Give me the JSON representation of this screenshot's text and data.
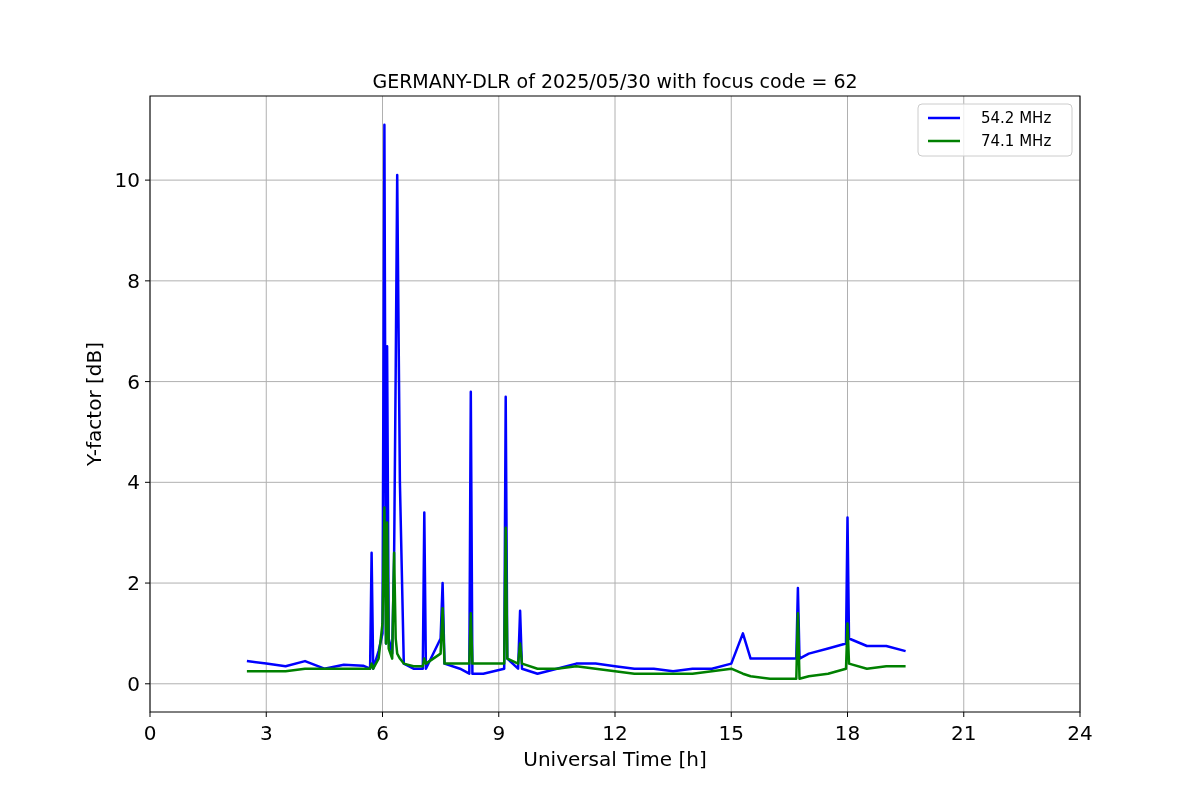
{
  "figure": {
    "chart_data": {
      "type": "line",
      "title": "GERMANY-DLR of 2025/05/30 with focus code = 62",
      "xlabel": "Universal Time [h]",
      "ylabel": "Y-factor [dB]",
      "x": [
        2.5,
        3,
        3.5,
        4,
        4.5,
        5,
        5.5,
        5.68,
        5.72,
        5.76,
        5.9,
        6.0,
        6.05,
        6.09,
        6.12,
        6.16,
        6.25,
        6.3,
        6.34,
        6.38,
        6.45,
        6.55,
        6.8,
        7.04,
        7.08,
        7.12,
        7.5,
        7.55,
        7.6,
        8.0,
        8.24,
        8.28,
        8.32,
        8.6,
        9.14,
        9.18,
        9.22,
        9.5,
        9.55,
        9.6,
        10,
        10.5,
        11,
        11.5,
        12,
        12.5,
        13,
        13.5,
        14,
        14.5,
        15,
        15.3,
        15.5,
        16,
        16.5,
        16.68,
        16.72,
        16.76,
        17,
        17.5,
        17.96,
        18.0,
        18.04,
        18.5,
        19,
        19.5
      ],
      "series": [
        {
          "name": "54.2 MHz",
          "color": "#0000ff",
          "values": [
            0.45,
            0.4,
            0.35,
            0.45,
            0.3,
            0.38,
            0.36,
            0.3,
            2.6,
            0.3,
            0.65,
            1.0,
            11.1,
            0.8,
            6.7,
            0.9,
            0.6,
            2.5,
            6.2,
            10.1,
            4.0,
            0.4,
            0.3,
            0.3,
            3.4,
            0.3,
            0.9,
            2.0,
            0.4,
            0.3,
            0.2,
            5.8,
            0.2,
            0.2,
            0.3,
            5.7,
            0.5,
            0.3,
            1.45,
            0.3,
            0.2,
            0.3,
            0.4,
            0.4,
            0.35,
            0.3,
            0.3,
            0.25,
            0.3,
            0.3,
            0.4,
            1.0,
            0.5,
            0.5,
            0.5,
            0.5,
            1.9,
            0.5,
            0.6,
            0.7,
            0.8,
            3.3,
            0.9,
            0.75,
            0.75,
            0.65
          ]
        },
        {
          "name": "74.1 MHz",
          "color": "#008000",
          "values": [
            0.25,
            0.25,
            0.25,
            0.3,
            0.3,
            0.3,
            0.3,
            0.3,
            0.4,
            0.3,
            0.5,
            1.2,
            3.5,
            0.8,
            3.2,
            0.7,
            0.5,
            2.6,
            0.9,
            0.6,
            0.5,
            0.4,
            0.35,
            0.35,
            0.5,
            0.4,
            0.6,
            1.5,
            0.4,
            0.4,
            0.4,
            1.4,
            0.4,
            0.4,
            0.4,
            3.1,
            0.5,
            0.4,
            0.8,
            0.4,
            0.3,
            0.3,
            0.35,
            0.3,
            0.25,
            0.2,
            0.2,
            0.2,
            0.2,
            0.25,
            0.3,
            0.2,
            0.15,
            0.1,
            0.1,
            0.1,
            1.4,
            0.1,
            0.15,
            0.2,
            0.3,
            1.2,
            0.4,
            0.3,
            0.35,
            0.35
          ]
        }
      ],
      "xlim": [
        0,
        24
      ],
      "ylim": [
        -0.56,
        11.67
      ],
      "xticks": [
        0,
        3,
        6,
        9,
        12,
        15,
        18,
        21,
        24
      ],
      "yticks": [
        0,
        2,
        4,
        6,
        8,
        10
      ],
      "grid": true,
      "legend": true
    }
  }
}
